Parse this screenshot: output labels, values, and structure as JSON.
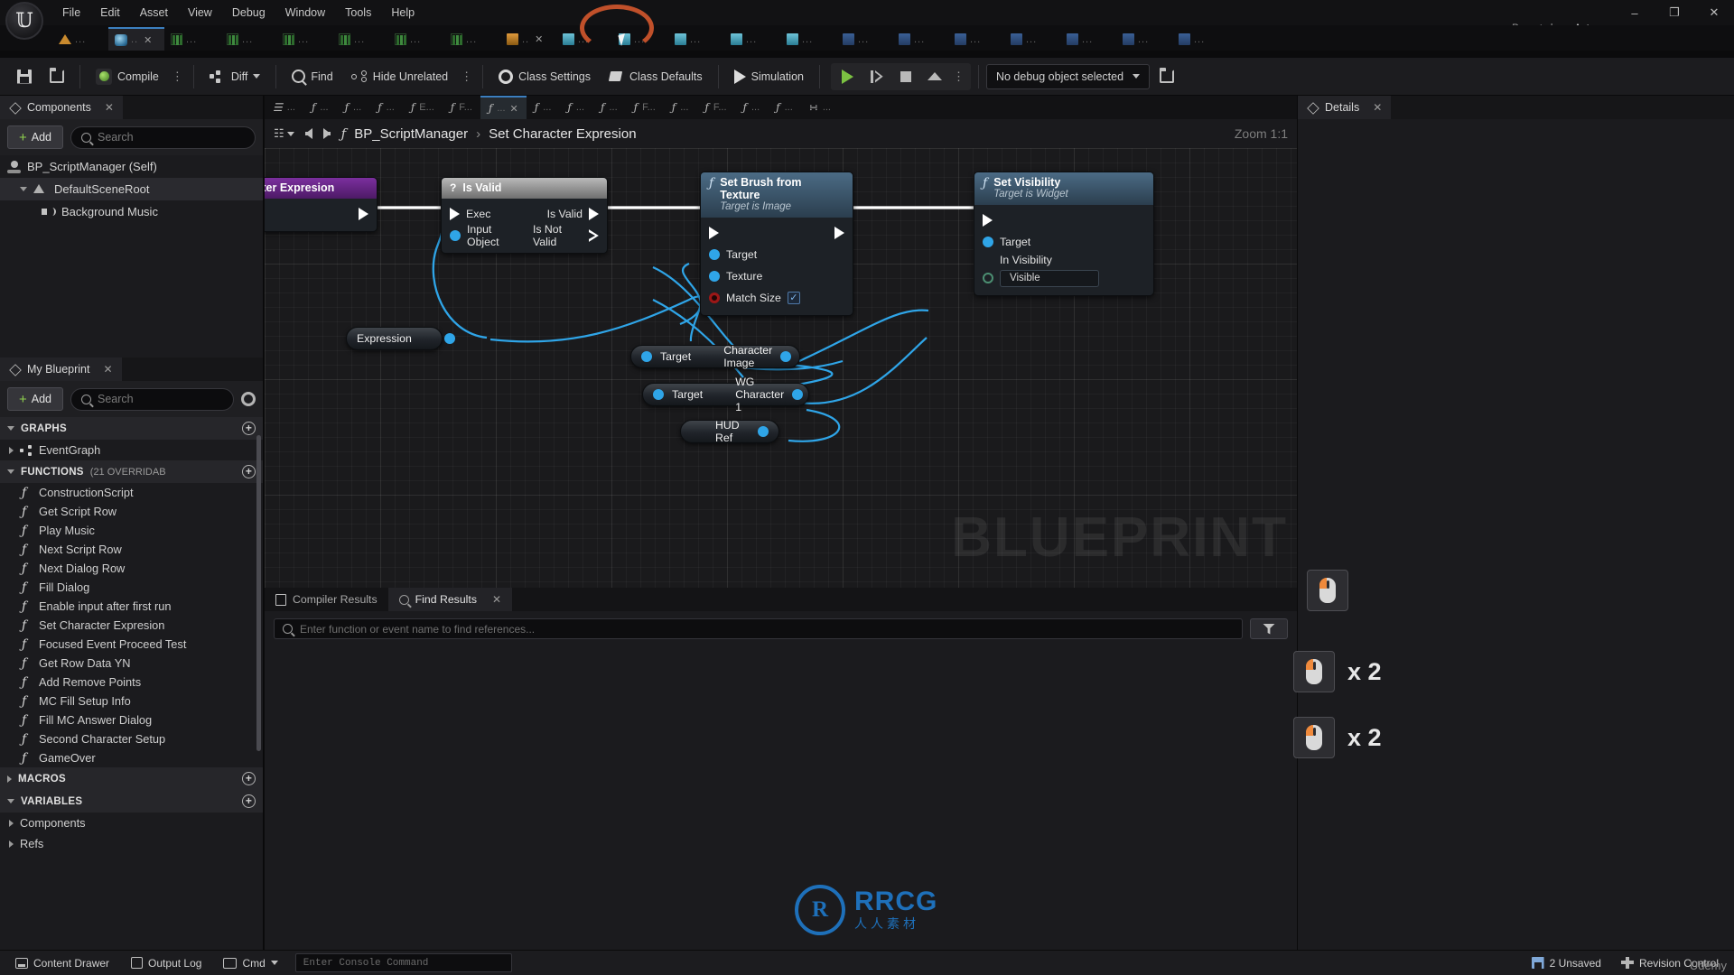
{
  "window": {
    "parent_class_label": "Parent class:",
    "parent_class_value": "Actor",
    "minimize": "–",
    "restore": "❐",
    "close": "✕"
  },
  "menubar": {
    "items": [
      "File",
      "Edit",
      "Asset",
      "View",
      "Debug",
      "Window",
      "Tools",
      "Help"
    ]
  },
  "asset_tabs": [
    {
      "icon": "terrain-icon",
      "label": "...",
      "active": false
    },
    {
      "icon": "sphere-icon",
      "label": "..",
      "active": true,
      "closable": true
    },
    {
      "icon": "bars-icon",
      "label": "...",
      "active": false
    },
    {
      "icon": "bars-icon",
      "label": "...",
      "active": false
    },
    {
      "icon": "bars-icon",
      "label": "...",
      "active": false
    },
    {
      "icon": "bars-icon",
      "label": "...",
      "active": false
    },
    {
      "icon": "bars-icon",
      "label": "...",
      "active": false
    },
    {
      "icon": "bars-icon",
      "label": "...",
      "active": false
    },
    {
      "icon": "orange-icon",
      "label": "..",
      "active": false,
      "closable": true
    },
    {
      "icon": "blue-icon",
      "label": "...",
      "active": false
    },
    {
      "icon": "blue-icon",
      "label": "...",
      "active": false
    },
    {
      "icon": "blue-icon",
      "label": "...",
      "active": false
    },
    {
      "icon": "blue-icon",
      "label": "...",
      "active": false
    },
    {
      "icon": "blue-icon",
      "label": "...",
      "active": false
    },
    {
      "icon": "blue2-icon",
      "label": "...",
      "active": false
    },
    {
      "icon": "blue2-icon",
      "label": "...",
      "active": false
    },
    {
      "icon": "blue2-icon",
      "label": "...",
      "active": false
    },
    {
      "icon": "blue2-icon",
      "label": "...",
      "active": false
    },
    {
      "icon": "blue2-icon",
      "label": "...",
      "active": false
    },
    {
      "icon": "blue2-icon",
      "label": "...",
      "active": false
    },
    {
      "icon": "blue2-icon",
      "label": "...",
      "active": false
    }
  ],
  "toolbar": {
    "save": "",
    "browse": "",
    "compile": "Compile",
    "diff": "Diff",
    "find": "Find",
    "hide_unrelated": "Hide Unrelated",
    "class_settings": "Class Settings",
    "class_defaults": "Class Defaults",
    "simulation": "Simulation",
    "debug_object": "No debug object selected",
    "kebab": "⋮"
  },
  "components": {
    "tab_label": "Components",
    "close": "✕",
    "add_label": "Add",
    "search_placeholder": "Search",
    "tree": [
      {
        "label": "BP_ScriptManager (Self)",
        "icon": "self-icon",
        "indent": 0,
        "selected": false
      },
      {
        "label": "DefaultSceneRoot",
        "icon": "scene-root-icon",
        "indent": 1,
        "selected": true
      },
      {
        "label": "Background Music",
        "icon": "audio-icon",
        "indent": 2,
        "selected": false
      }
    ]
  },
  "my_blueprint": {
    "tab_label": "My Blueprint",
    "close": "✕",
    "add_label": "Add",
    "search_placeholder": "Search",
    "sections": {
      "graphs": {
        "title": "GRAPHS",
        "items": [
          "EventGraph"
        ]
      },
      "functions": {
        "title": "FUNCTIONS",
        "count": "(21 OVERRIDAB",
        "items": [
          "ConstructionScript",
          "Get Script Row",
          "Play Music",
          "Next Script Row",
          "Next Dialog Row",
          "Fill Dialog",
          "Enable input after first run",
          "Set Character Expresion",
          "Focused Event Proceed Test",
          "Get Row Data YN",
          "Add Remove Points",
          "MC Fill Setup Info",
          "Fill MC Answer Dialog",
          "Second Character Setup",
          "GameOver"
        ]
      },
      "macros": {
        "title": "MACROS",
        "items": []
      },
      "variables": {
        "title": "VARIABLES",
        "items": [
          "Components",
          "Refs"
        ]
      }
    }
  },
  "graph": {
    "tabs": [
      {
        "label": "...",
        "icon": "doc-icon"
      },
      {
        "label": "...",
        "icon": "fx-icon"
      },
      {
        "label": "...",
        "icon": "fx-icon"
      },
      {
        "label": "...",
        "icon": "fx-icon"
      },
      {
        "label": "E...",
        "icon": "fx-icon"
      },
      {
        "label": "F...",
        "icon": "fx-icon"
      },
      {
        "label": "...",
        "icon": "fx-icon",
        "active": true,
        "closable": true
      },
      {
        "label": "...",
        "icon": "fx-icon"
      },
      {
        "label": "...",
        "icon": "fx-icon"
      },
      {
        "label": "...",
        "icon": "fx-icon"
      },
      {
        "label": "F...",
        "icon": "fx-icon"
      },
      {
        "label": "...",
        "icon": "fx-icon"
      },
      {
        "label": "F...",
        "icon": "fx-icon"
      },
      {
        "label": "...",
        "icon": "fx-icon"
      },
      {
        "label": "...",
        "icon": "fx-icon"
      },
      {
        "label": "...",
        "icon": "graph-icon"
      }
    ],
    "breadcrumb_root": "BP_ScriptManager",
    "breadcrumb_sep": "›",
    "breadcrumb_current": "Set Character Expresion",
    "zoom_label": "Zoom 1:1",
    "watermark": "BLUEPRINT",
    "nodes": {
      "character_expresion": {
        "title": "Character Expresion",
        "type": "event"
      },
      "is_valid": {
        "title": "Is Valid",
        "inputs": [
          "Exec",
          "Input Object"
        ],
        "outputs": [
          "Is Valid",
          "Is Not Valid"
        ]
      },
      "set_brush_from_texture": {
        "title": "Set Brush from Texture",
        "subtitle": "Target is Image",
        "inputs": [
          "Target",
          "Texture",
          "Match Size"
        ],
        "match_size_checked": true
      },
      "set_visibility": {
        "title": "Set Visibility",
        "subtitle": "Target is Widget",
        "inputs": [
          "Target",
          "In Visibility"
        ],
        "visibility_value": "Visible"
      },
      "expression_var": {
        "label": "Expression"
      },
      "character_image_var": {
        "input": "Target",
        "output": "Character Image"
      },
      "wg_character_var": {
        "input": "Target",
        "output": "WG Character 1"
      },
      "hud_ref_var": {
        "output": "HUD Ref"
      }
    }
  },
  "details": {
    "tab_label": "Details",
    "close": "✕"
  },
  "mouse_hints": [
    {
      "multiplier": ""
    },
    {
      "multiplier": "x 2"
    },
    {
      "multiplier": "x 2"
    }
  ],
  "results": {
    "tabs": [
      {
        "label": "Compiler Results",
        "icon": "compiler-icon",
        "active": false
      },
      {
        "label": "Find Results",
        "icon": "search-icon",
        "active": true,
        "closable": true
      }
    ],
    "find_placeholder": "Enter function or event name to find references..."
  },
  "statusbar": {
    "content_drawer": "Content Drawer",
    "output_log": "Output Log",
    "cmd": "Cmd",
    "console_placeholder": "Enter Console Command",
    "unsaved": "2 Unsaved",
    "revision_control": "Revision Control",
    "udemy": "Udemy"
  },
  "watermark_logo": {
    "mark": "R",
    "title": "RRCG",
    "subtitle": "人人素材"
  }
}
